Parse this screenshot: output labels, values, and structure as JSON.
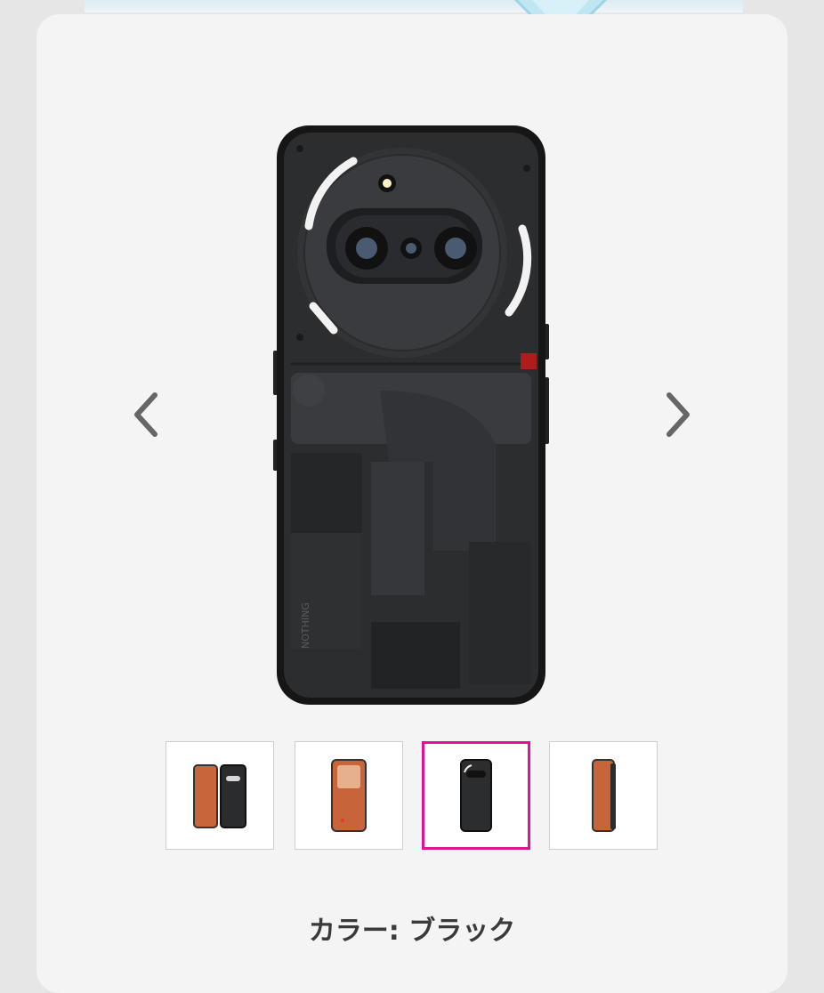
{
  "product_gallery": {
    "prev_icon": "chevron-left-icon",
    "next_icon": "chevron-right-icon",
    "selected_index": 2,
    "accent_color": "#e0129a",
    "thumbnails": [
      {
        "variant": "black-and-orange-pair"
      },
      {
        "variant": "orange-front"
      },
      {
        "variant": "black-back"
      },
      {
        "variant": "orange-side"
      }
    ],
    "phone_back_mark": "NOTHING"
  },
  "color": {
    "label": "カラー: ブラック"
  }
}
